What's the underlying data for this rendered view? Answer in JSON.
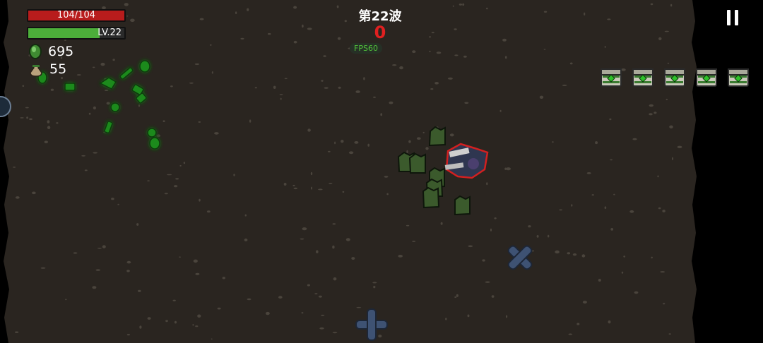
{
  "hud": {
    "hp_text": "104/104",
    "hp_fraction": 1.0,
    "level_text": "LV.22",
    "xp_fraction": 0.74,
    "gems": "695",
    "bags": "55",
    "gem_icon": "green-gem-icon",
    "bag_icon": "loot-bag-icon"
  },
  "wave": {
    "title": "第22波",
    "kills": "0",
    "fps": "FPS60"
  },
  "chests": {
    "count": 5,
    "icon": "treasure-chest-icon"
  },
  "colors": {
    "ground": "#2a2520",
    "hp_red": "#b81c1c",
    "xp_green": "#4cae3a",
    "kill_red": "#e02020",
    "fps_green": "#52c23a",
    "enemy_green": "#3b5a2c",
    "glow_green": "#22c41a"
  }
}
